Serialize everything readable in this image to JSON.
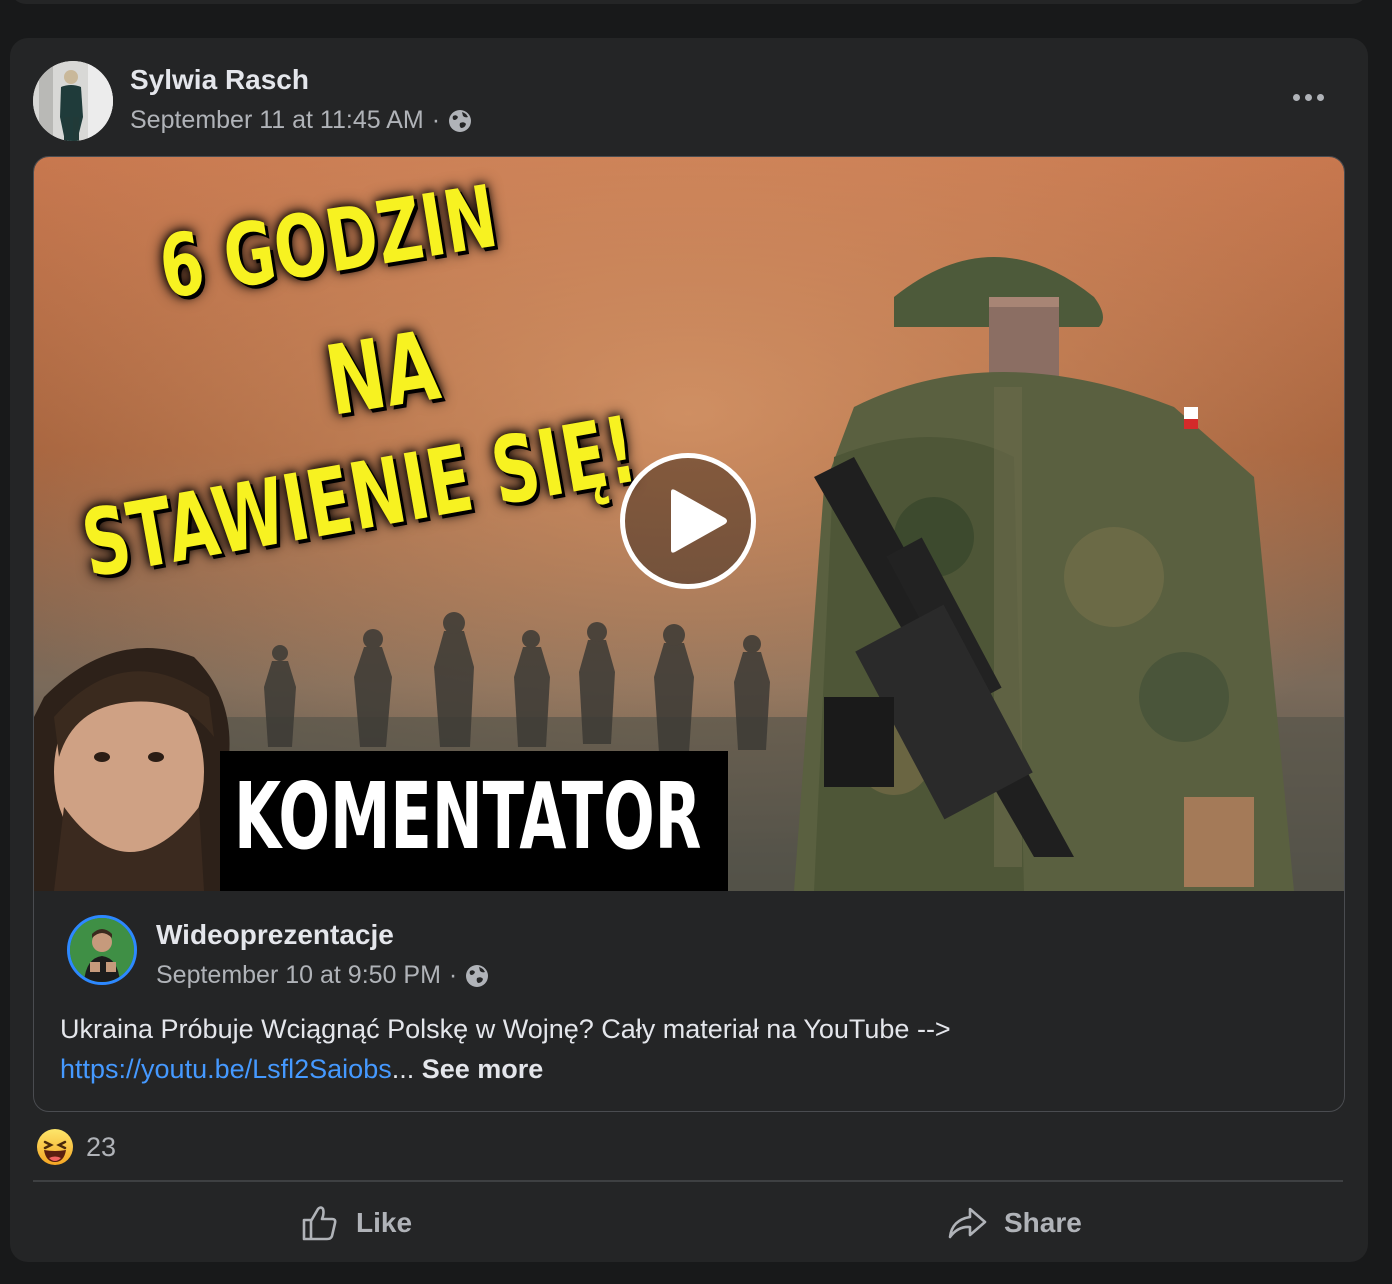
{
  "post": {
    "author": "Sylwia Rasch",
    "timestamp": "September 11 at 11:45 AM",
    "separator": "·",
    "audience_icon": "globe-icon",
    "more_icon": "ellipsis-icon"
  },
  "shared_post": {
    "thumbnail": {
      "headline_lines": [
        "6 GODZIN",
        "NA",
        "STAWIENIE SIĘ!"
      ],
      "caption": "KOMENTATOR",
      "play_icon": "play-icon"
    },
    "author": "Wideoprezentacje",
    "timestamp": "September 10 at 9:50 PM",
    "separator": "·",
    "audience_icon": "globe-icon",
    "text": "Ukraina Próbuje Wciągnąć Polskę w Wojnę? Cały materiał na YouTube -->",
    "link": "https://youtu.be/Lsfl2Saiobs",
    "ellipsis": "...",
    "see_more": "See more"
  },
  "reactions": {
    "icon": "haha-emoji-icon",
    "count": "23"
  },
  "actions": {
    "like": "Like",
    "share": "Share"
  },
  "colors": {
    "background": "#18191a",
    "card": "#242526",
    "link": "#4599ff",
    "secondary_text": "#b0b3b8",
    "headline_yellow": "#f7f221"
  }
}
